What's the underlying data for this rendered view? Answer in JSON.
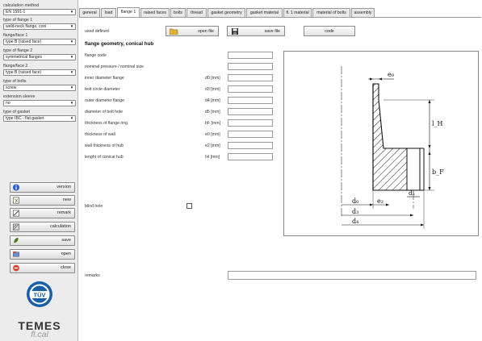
{
  "sidebar": {
    "calculation_method_label": "calculation method",
    "calculation_method_value": "EN 1591-1",
    "flange1_type_label": "type of flange 1",
    "flange1_type_value": "weld-neck flange, coni",
    "flangeface1_label": "flange/face 1",
    "flangeface1_value": "type B (raised face)",
    "flange2_type_label": "type of flange 2",
    "flange2_type_value": "symmetrical flanges",
    "flangeface2_label": "flange/face 2",
    "flangeface2_value": "type B (raised face)",
    "bolts_type_label": "type of bolts",
    "bolts_type_value": "screw",
    "extension_sleeve_label": "extension sleeve",
    "extension_sleeve_value": "no",
    "gasket_type_label": "type of gasket",
    "gasket_type_value": "type IBC - flat gasket",
    "buttons": {
      "version": "version",
      "new": "new",
      "remark": "remark",
      "calculation": "calculation",
      "save": "save",
      "open": "open",
      "close": "close"
    },
    "brand_name": "TEMES",
    "brand_sub": "fl.cal",
    "logo_text": "TÜV"
  },
  "tabs": [
    {
      "label": "general",
      "active": false
    },
    {
      "label": "load",
      "active": false
    },
    {
      "label": "flange 1",
      "active": true
    },
    {
      "label": "raised faces",
      "active": false
    },
    {
      "label": "bolts",
      "active": false
    },
    {
      "label": "thread",
      "active": false
    },
    {
      "label": "gasket geometry",
      "active": false
    },
    {
      "label": "gasket material",
      "active": false
    },
    {
      "label": "fl. 1 material",
      "active": false
    },
    {
      "label": "material of bolts",
      "active": false
    },
    {
      "label": "assembly",
      "active": false
    }
  ],
  "main": {
    "used_defined": "used defined",
    "open_file": "open file",
    "save_file": "save file",
    "code_button": "code",
    "section_title": "flange geometry, conical hub",
    "fields": [
      {
        "label": "flange code",
        "symbol": ""
      },
      {
        "label": "nominal pressure / nominal size",
        "symbol": ""
      },
      {
        "label": "inner diameter flange",
        "symbol": "d0 [mm]"
      },
      {
        "label": "bolt circle diameter",
        "symbol": "d3 [mm]"
      },
      {
        "label": "outer diameter flange",
        "symbol": "d4 [mm]"
      },
      {
        "label": "diameter of bolt hole",
        "symbol": "d5 [mm]"
      },
      {
        "label": "thickness of flange ring",
        "symbol": "bF [mm]"
      },
      {
        "label": "thickness of wall",
        "symbol": "e0 [mm]"
      },
      {
        "label": "wall thickness of hub",
        "symbol": "e2 [mm]"
      },
      {
        "label": "lenght of conical hub",
        "symbol": "IH [mm]"
      }
    ],
    "blind_hole": "blind hole",
    "remarks": "remarks"
  },
  "drawing_labels": {
    "e0": "e₀",
    "e2": "e₂",
    "d0": "d₀",
    "d3": "d₃",
    "d4": "d₄",
    "d5": "d₅",
    "lH": "l_H",
    "bF": "b_F"
  },
  "colors": {
    "sidebar_bg": "#ececec",
    "tab_bg": "#e9e9e9",
    "border": "#9a9a9a"
  }
}
